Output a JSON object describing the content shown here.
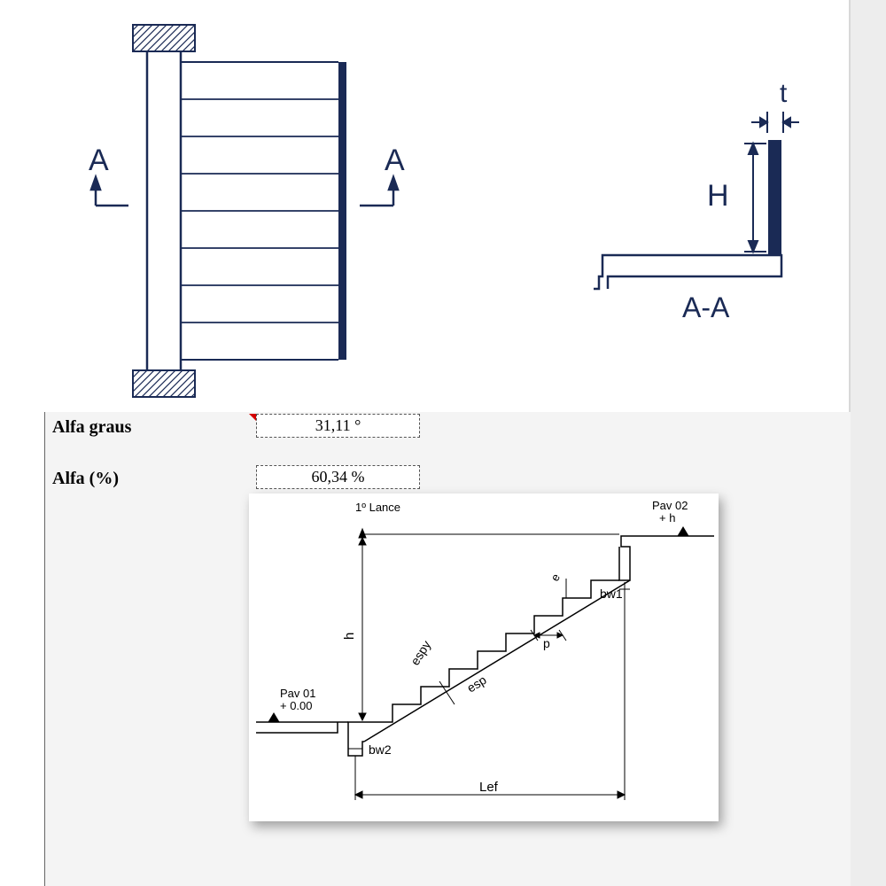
{
  "top_diagram": {
    "label_A_left": "A",
    "label_A_right": "A",
    "label_t": "t",
    "label_H": "H",
    "section_label": "A-A"
  },
  "fields": {
    "alfa_graus_label": "Alfa graus",
    "alfa_graus_value": "31,11 °",
    "alfa_pct_label": "Alfa (%)",
    "alfa_pct_value": "60,34 %"
  },
  "stair_diagram": {
    "title": "1º Lance",
    "pav01_label": "Pav 01",
    "pav01_elev": "+ 0.00",
    "pav02_label": "Pav 02",
    "pav02_elev": "+ h",
    "h": "h",
    "e": "e",
    "p": "p",
    "espy": "espy",
    "esp": "esp",
    "bw1": "bw1",
    "bw2": "bw2",
    "lef": "Lef"
  }
}
